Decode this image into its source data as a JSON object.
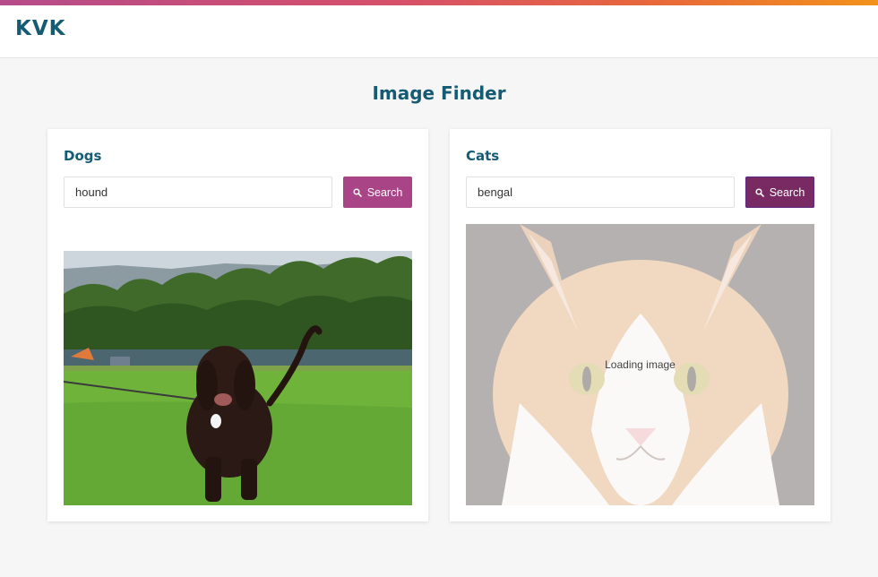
{
  "brand": {
    "logo": "KVK"
  },
  "page": {
    "title": "Image Finder"
  },
  "cards": {
    "dogs": {
      "title": "Dogs",
      "input_value": "hound",
      "button_label": "Search",
      "image_alt": "Black curly-haired dog on grass by a lake"
    },
    "cats": {
      "title": "Cats",
      "input_value": "bengal",
      "button_label": "Search",
      "loading_text": "Loading image",
      "image_alt": "Orange and white cat face"
    }
  },
  "colors": {
    "brand": "#155b74",
    "search_button": "#a94486",
    "search_button_active": "#7a2a62",
    "accent_gradient_start": "#b54b8a",
    "accent_gradient_end": "#f2921a"
  },
  "icons": {
    "search": "search-icon"
  }
}
